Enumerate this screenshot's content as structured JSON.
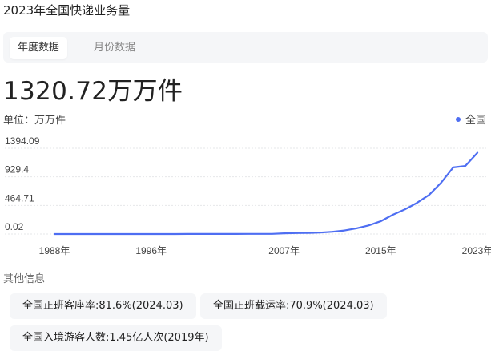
{
  "header": {
    "title": "2023年全国快递业务量"
  },
  "tabs": [
    {
      "label": "年度数据",
      "active": true
    },
    {
      "label": "月份数据",
      "active": false
    }
  ],
  "summary": {
    "value": "1320.72万万件",
    "unit_label": "单位：万万件"
  },
  "chart_data": {
    "type": "line",
    "series": [
      {
        "name": "全国",
        "color": "#4e6ef2",
        "x": [
          1988,
          1989,
          1990,
          1991,
          1992,
          1993,
          1994,
          1995,
          1996,
          1997,
          1998,
          1999,
          2000,
          2001,
          2002,
          2003,
          2004,
          2005,
          2006,
          2007,
          2008,
          2009,
          2010,
          2011,
          2012,
          2013,
          2014,
          2015,
          2016,
          2017,
          2018,
          2019,
          2020,
          2021,
          2022,
          2023
        ],
        "values": [
          0.02,
          0.05,
          0.08,
          0.1,
          0.15,
          0.2,
          0.25,
          0.3,
          0.4,
          0.5,
          0.6,
          0.8,
          1.1,
          1.3,
          1.4,
          1.7,
          2.0,
          2.3,
          2.7,
          12.0,
          15.1,
          18.6,
          23.4,
          36.7,
          56.9,
          91.9,
          139.6,
          206.7,
          312.8,
          400.6,
          507.1,
          635.2,
          833.6,
          1083.0,
          1105.8,
          1320.72
        ]
      }
    ],
    "y_ticks": [
      "1394.09",
      "929.4",
      "464.71",
      "0.02"
    ],
    "x_ticks": [
      "1988年",
      "1996年",
      "2007年",
      "2015年",
      "2023年"
    ],
    "ylim": [
      0.02,
      1394.09
    ],
    "xlim": [
      1988,
      2023
    ],
    "grid": "horizontal-dashed",
    "legend": "top-right"
  },
  "other_info": {
    "heading": "其他信息",
    "chips": [
      "全国正班客座率:81.6%(2024.03)",
      "全国正班载运率:70.9%(2024.03)",
      "全国入境游客人数:1.45亿人次(2019年)"
    ]
  }
}
